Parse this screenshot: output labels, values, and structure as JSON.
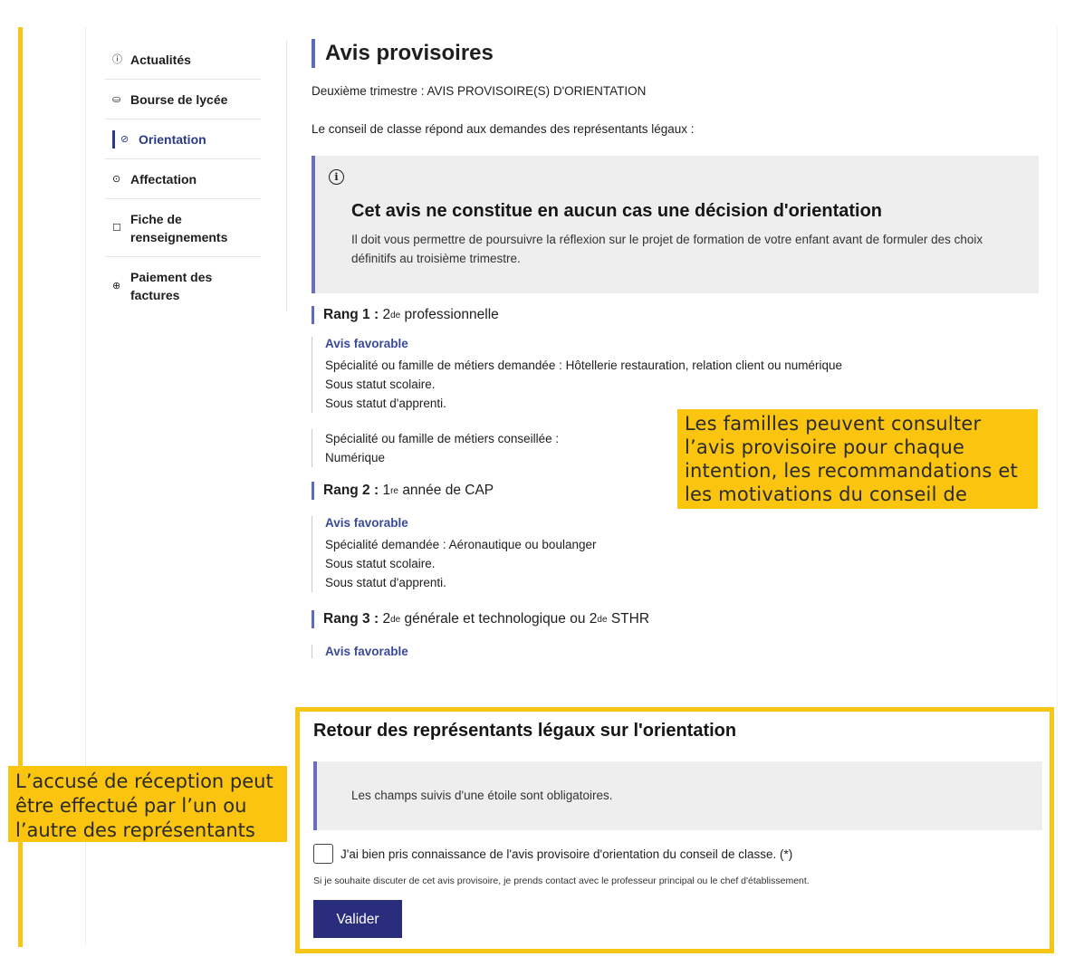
{
  "sidebar": {
    "items": [
      {
        "icon": "info-circle-icon",
        "glyph": "ⓘ",
        "label": "Actualités",
        "active": false
      },
      {
        "icon": "hands-coins-icon",
        "glyph": "⛀",
        "label": "Bourse de lycée",
        "active": false
      },
      {
        "icon": "compass-icon",
        "glyph": "⊘",
        "label": "Orientation",
        "active": true
      },
      {
        "icon": "target-icon",
        "glyph": "⊙",
        "label": "Affectation",
        "active": false
      },
      {
        "icon": "edit-file-icon",
        "glyph": "☐",
        "label_line1": "Fiche de",
        "label_line2": "renseignements",
        "active": false
      },
      {
        "icon": "payment-icon",
        "glyph": "⊕",
        "label_line1": "Paiement des",
        "label_line2": "factures",
        "active": false
      }
    ]
  },
  "main": {
    "title": "Avis provisoires",
    "subtitle": "Deuxième trimestre : AVIS PROVISOIRE(S) D'ORIENTATION",
    "intro": "Le conseil de classe répond aux demandes des représentants légaux :",
    "callout": {
      "icon": "info-icon",
      "title": "Cet avis ne constitue en aucun cas une décision d'orientation",
      "text": "Il doit vous permettre de poursuivre la réflexion sur le projet de formation de votre enfant avant de formuler des choix définitifs au troisième trimestre."
    },
    "rangs": [
      {
        "label": "Rang 1 :",
        "level": "2",
        "sup": "de",
        "formation": "professionnelle",
        "avis": "Avis favorable",
        "lines": [
          "Spécialité ou famille de métiers demandée : Hôtellerie restauration, relation client ou numérique",
          "Sous statut scolaire.",
          "Sous statut d'apprenti."
        ],
        "conseil_label": "Spécialité ou famille de métiers conseillée :",
        "conseil_value": "Numérique"
      },
      {
        "label": "Rang 2 :",
        "level": "1",
        "sup": "re",
        "formation": "année de CAP",
        "avis": "Avis favorable",
        "lines": [
          "Spécialité demandée : Aéronautique ou boulanger",
          "Sous statut scolaire.",
          "Sous statut d'apprenti."
        ]
      },
      {
        "label": "Rang 3 :",
        "level": "2",
        "sup": "de",
        "formation": "générale et technologique ou 2",
        "sup2": "de",
        "formation2": "STHR",
        "avis": "Avis favorable"
      }
    ]
  },
  "retour": {
    "title": "Retour des représentants légaux sur l'orientation",
    "mandatory_note": "Les champs suivis d'une étoile sont obligatoires.",
    "checkbox_label": "J'ai bien pris connaissance de l'avis provisoire d'orientation du conseil de classe. (*)",
    "checkbox_checked": false,
    "hint": "Si je souhaite discuter de cet avis provisoire, je prends contact avec le professeur principal ou le chef d'établissement.",
    "submit_label": "Valider"
  },
  "annotations": {
    "right": "Les familles peuvent consulter l’avis provisoire pour chaque intention, les recommandations et les motivations du conseil de classe",
    "left": "L’accusé de réception peut être effectué par l’un ou l’autre des représentants"
  },
  "colors": {
    "accent_blue": "#2b3a84",
    "button_blue": "#2a2d7c",
    "highlight_yellow": "#fbc50f",
    "callout_bg": "#eeeeee"
  }
}
